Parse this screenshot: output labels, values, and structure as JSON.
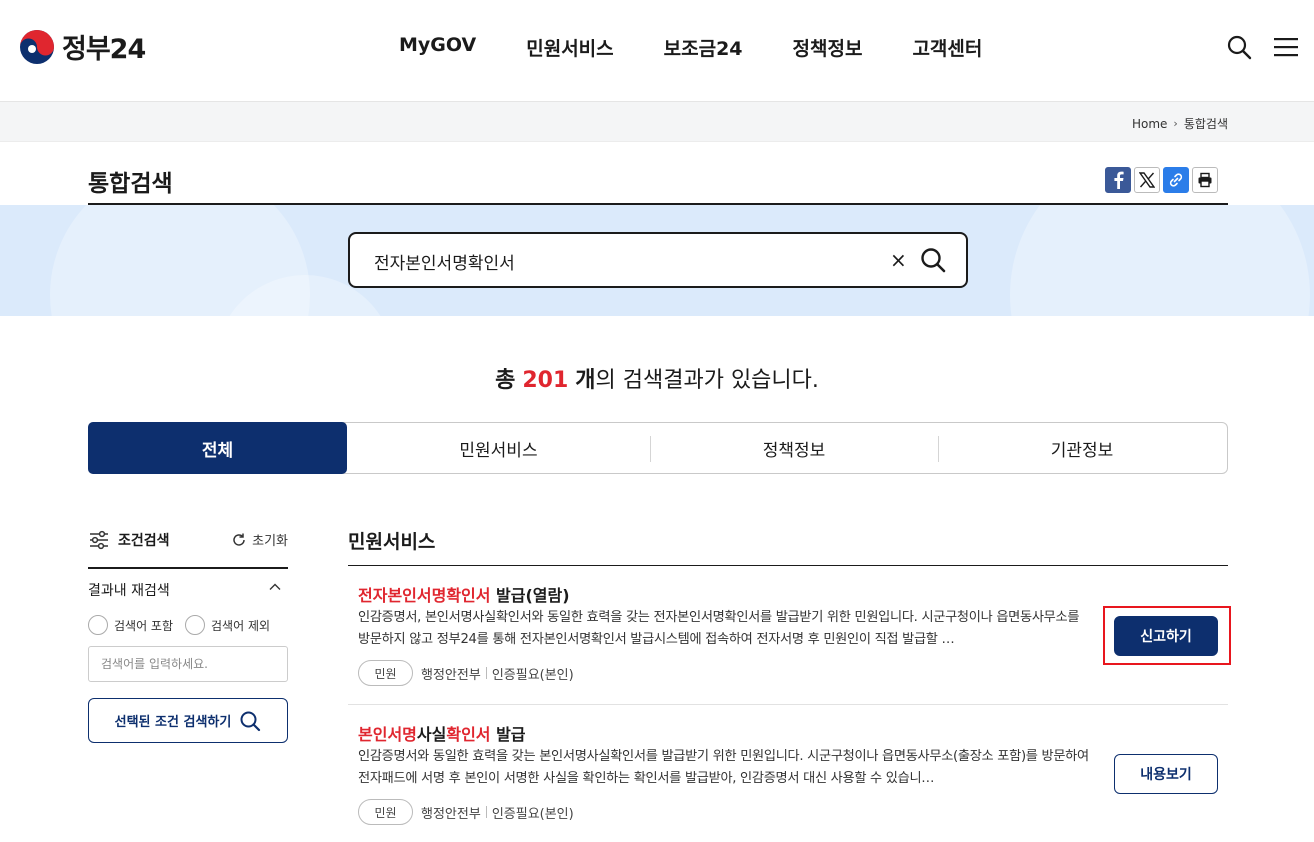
{
  "header": {
    "logo_text": "정부24",
    "nav": [
      "MyGOV",
      "민원서비스",
      "보조금24",
      "정책정보",
      "고객센터"
    ]
  },
  "breadcrumb": {
    "home": "Home",
    "current": "통합검색"
  },
  "page": {
    "title": "통합검색"
  },
  "search": {
    "query": "전자본인서명확인서",
    "clear": "×"
  },
  "summary": {
    "prefix": "총",
    "count": "201",
    "unit": "개",
    "suffix": "의 검색결과가 있습니다."
  },
  "tabs": [
    "전체",
    "민원서비스",
    "정책정보",
    "기관정보"
  ],
  "filter": {
    "title": "조건검색",
    "reset": "초기화",
    "refine_title": "결과내 재검색",
    "include": "검색어 포함",
    "exclude": "검색어 제외",
    "input_placeholder": "검색어를 입력하세요.",
    "submit": "선택된 조건 검색하기"
  },
  "section": {
    "title": "민원서비스"
  },
  "results": [
    {
      "title_hl": "전자본인서명확인서",
      "title_rest": " 발급(열람)",
      "desc": "인감증명서, 본인서명사실확인서와 동일한 효력을 갖는 전자본인서명확인서를 발급받기 위한 민원입니다. 시군구청이나 읍면동사무소를 방문하지 않고 정부24를 통해 전자본인서명확인서 발급시스템에 접속하여 전자서명 후 민원인이 직접 발급할 …",
      "chip": "민원",
      "agency": "행정안전부",
      "auth": "인증필요(본인)",
      "button": "신고하기"
    },
    {
      "title_hl1": "본인서명",
      "title_mid": "사실",
      "title_hl2": "확인서",
      "title_rest": " 발급",
      "desc": "인감증명서와 동일한 효력을 갖는 본인서명사실확인서를 발급받기 위한 민원입니다. 시군구청이나 읍면동사무소(출장소 포함)를 방문하여 전자패드에 서명 후 본인이 서명한 사실을 확인하는 확인서를 발급받아, 인감증명서 대신 사용할 수 있습니…",
      "chip": "민원",
      "agency": "행정안전부",
      "auth": "인증필요(본인)",
      "button": "내용보기"
    }
  ],
  "colors": {
    "navy": "#0d2f6e",
    "red": "#e0262f",
    "band": "#dbeafb"
  }
}
